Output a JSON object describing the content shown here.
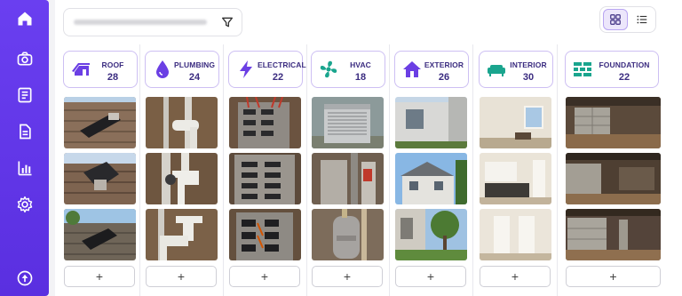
{
  "sidebar": {
    "items": [
      {
        "icon": "home-icon",
        "name": "sidebar-item-home"
      },
      {
        "icon": "camera-icon",
        "name": "sidebar-item-camera"
      },
      {
        "icon": "report-icon",
        "name": "sidebar-item-reports"
      },
      {
        "icon": "document-icon",
        "name": "sidebar-item-documents"
      },
      {
        "icon": "bar-chart-icon",
        "name": "sidebar-item-analytics"
      },
      {
        "icon": "gear-icon",
        "name": "sidebar-item-settings"
      }
    ],
    "bottom_icon": "help-icon"
  },
  "toolbar": {
    "filter_icon": "filter-icon",
    "grid_view_icon": "grid-view-icon",
    "list_view_icon": "list-view-icon",
    "active_view": "grid"
  },
  "categories": [
    {
      "label": "ROOF",
      "count": "28",
      "icon": "roof-icon"
    },
    {
      "label": "PLUMBING",
      "count": "24",
      "icon": "water-drop-icon"
    },
    {
      "label": "ELECTRICAL",
      "count": "22",
      "icon": "lightning-icon"
    },
    {
      "label": "HVAC",
      "count": "18",
      "icon": "fan-icon"
    },
    {
      "label": "EXTERIOR",
      "count": "26",
      "icon": "house-icon"
    },
    {
      "label": "INTERIOR",
      "count": "30",
      "icon": "sofa-icon"
    },
    {
      "label": "FOUNDATION",
      "count": "22",
      "icon": "brick-icon"
    }
  ],
  "add_label": "+",
  "colors": {
    "accent": "#6a3ff0",
    "icon_purple": "#6b3fe4",
    "icon_teal": "#1aa58e"
  }
}
